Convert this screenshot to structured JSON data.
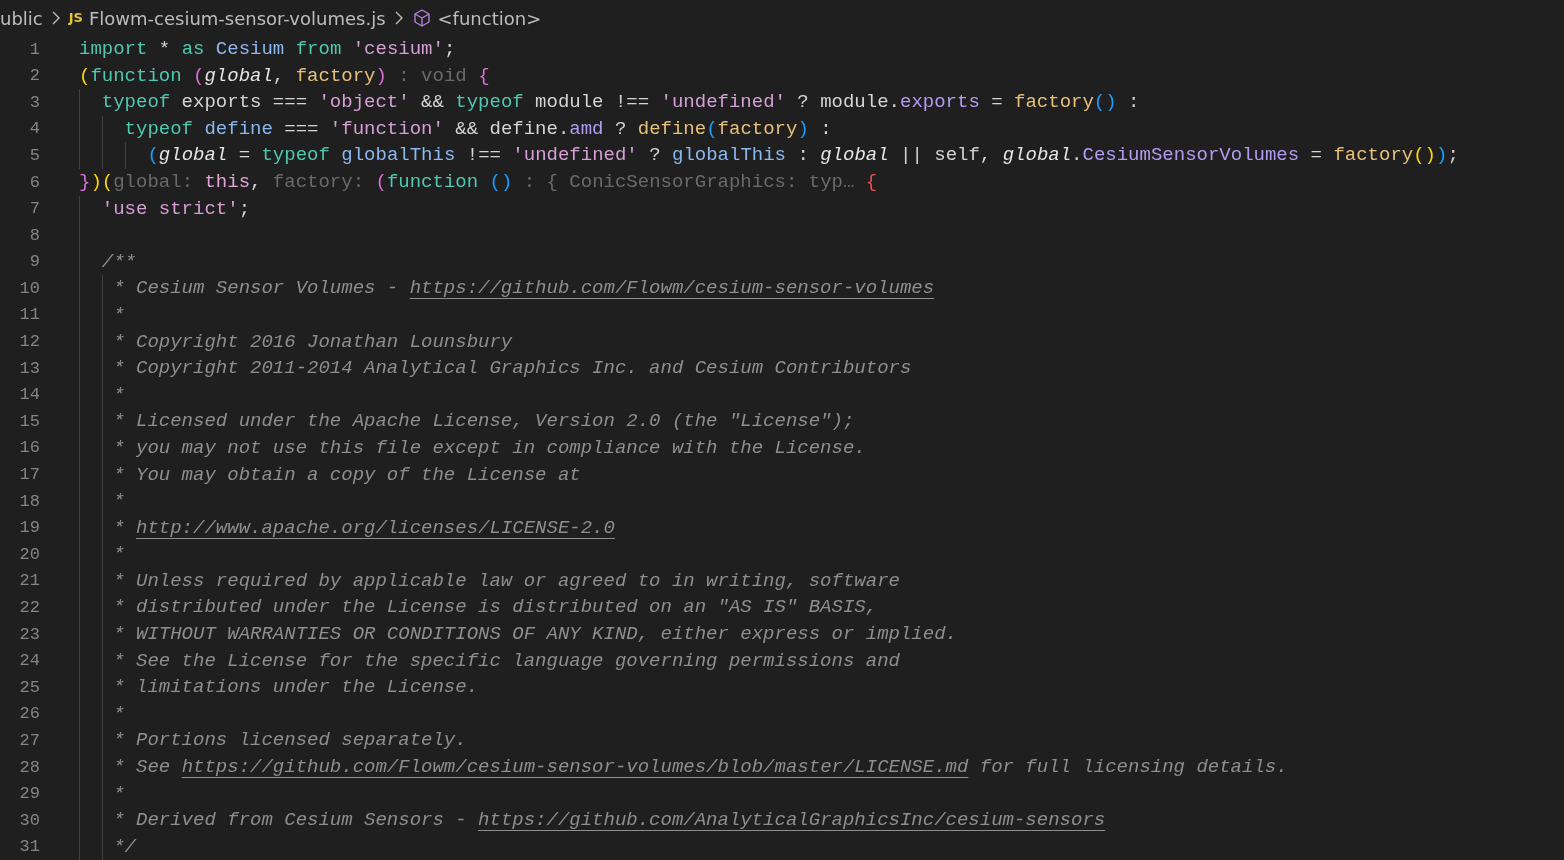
{
  "breadcrumb": [
    {
      "kind": "folder",
      "label": "ublic"
    },
    {
      "kind": "file",
      "badge": "JS",
      "label": "Flowm-cesium-sensor-volumes.js"
    },
    {
      "kind": "symbol",
      "label": "<function>"
    }
  ],
  "lines": [
    {
      "number": "1",
      "tokens": [
        {
          "kind": "kw",
          "text": "import"
        },
        {
          "kind": "plain",
          "text": " * "
        },
        {
          "kind": "kw",
          "text": "as "
        },
        {
          "kind": "var",
          "text": "Cesium "
        },
        {
          "kind": "kw",
          "text": "from "
        },
        {
          "kind": "str",
          "text": "'cesium'"
        },
        {
          "kind": "plain",
          "text": ";"
        }
      ]
    },
    {
      "number": "2",
      "tokens": [
        {
          "kind": "b1",
          "text": "("
        },
        {
          "kind": "kw",
          "text": "function "
        },
        {
          "kind": "b2",
          "text": "("
        },
        {
          "kind": "param",
          "text": "global"
        },
        {
          "kind": "plain",
          "text": ", "
        },
        {
          "kind": "fn",
          "text": "factory"
        },
        {
          "kind": "b2",
          "text": ")"
        },
        {
          "kind": "hint",
          "text": " : void "
        },
        {
          "kind": "b2",
          "text": "{"
        }
      ]
    },
    {
      "number": "3",
      "tokens": [
        {
          "kind": "kw",
          "text": "  typeof"
        },
        {
          "kind": "plain",
          "text": " exports === "
        },
        {
          "kind": "str",
          "text": "'object'"
        },
        {
          "kind": "plain",
          "text": " && "
        },
        {
          "kind": "kw",
          "text": "typeof"
        },
        {
          "kind": "plain",
          "text": " module !== "
        },
        {
          "kind": "str",
          "text": "'undefined'"
        },
        {
          "kind": "plain",
          "text": " ? module."
        },
        {
          "kind": "prop",
          "text": "exports"
        },
        {
          "kind": "plain",
          "text": " = "
        },
        {
          "kind": "fn",
          "text": "factory"
        },
        {
          "kind": "b3",
          "text": "()"
        },
        {
          "kind": "plain",
          "text": " :"
        }
      ]
    },
    {
      "number": "4",
      "tokens": [
        {
          "kind": "kw",
          "text": "    typeof "
        },
        {
          "kind": "var",
          "text": "define"
        },
        {
          "kind": "plain",
          "text": " === "
        },
        {
          "kind": "str",
          "text": "'function'"
        },
        {
          "kind": "plain",
          "text": " && define."
        },
        {
          "kind": "prop",
          "text": "amd"
        },
        {
          "kind": "plain",
          "text": " ? "
        },
        {
          "kind": "fn",
          "text": "define"
        },
        {
          "kind": "b3",
          "text": "("
        },
        {
          "kind": "fn",
          "text": "factory"
        },
        {
          "kind": "b3",
          "text": ")"
        },
        {
          "kind": "plain",
          "text": " :"
        }
      ]
    },
    {
      "number": "5",
      "tokens": [
        {
          "kind": "b3",
          "text": "      ("
        },
        {
          "kind": "param",
          "text": "global"
        },
        {
          "kind": "plain",
          "text": " = "
        },
        {
          "kind": "kw",
          "text": "typeof "
        },
        {
          "kind": "var",
          "text": "globalThis"
        },
        {
          "kind": "plain",
          "text": " !== "
        },
        {
          "kind": "str",
          "text": "'undefined'"
        },
        {
          "kind": "plain",
          "text": " ? "
        },
        {
          "kind": "var",
          "text": "globalThis"
        },
        {
          "kind": "plain",
          "text": " : "
        },
        {
          "kind": "param",
          "text": "global"
        },
        {
          "kind": "plain",
          "text": " || self, "
        },
        {
          "kind": "param",
          "text": "global"
        },
        {
          "kind": "plain",
          "text": "."
        },
        {
          "kind": "prop",
          "text": "CesiumSensorVolumes"
        },
        {
          "kind": "plain",
          "text": " = "
        },
        {
          "kind": "fn",
          "text": "factory"
        },
        {
          "kind": "b1",
          "text": "()"
        },
        {
          "kind": "b3",
          "text": ")"
        },
        {
          "kind": "plain",
          "text": ";"
        }
      ]
    },
    {
      "number": "6",
      "tokens": [
        {
          "kind": "b2",
          "text": "}"
        },
        {
          "kind": "b1",
          "text": ")("
        },
        {
          "kind": "hint",
          "text": "global: "
        },
        {
          "kind": "this",
          "text": "this"
        },
        {
          "kind": "plain",
          "text": ", "
        },
        {
          "kind": "hint",
          "text": "factory: "
        },
        {
          "kind": "b2",
          "text": "("
        },
        {
          "kind": "kw",
          "text": "function "
        },
        {
          "kind": "b3",
          "text": "()"
        },
        {
          "kind": "hint",
          "text": " : { ConicSensorGraphics: typ… "
        },
        {
          "kind": "berr",
          "text": "{"
        }
      ]
    },
    {
      "number": "7",
      "tokens": [
        {
          "kind": "str",
          "text": "  'use strict'"
        },
        {
          "kind": "plain",
          "text": ";"
        }
      ]
    },
    {
      "number": "8"
    },
    {
      "number": "9",
      "tokens": [
        {
          "kind": "cmt",
          "text": "  /**"
        }
      ]
    },
    {
      "number": "10",
      "tokens": [
        {
          "kind": "cmt",
          "text": "   * Cesium Sensor Volumes - "
        },
        {
          "kind": "link",
          "text": "https://github.com/Flowm/cesium-sensor-volumes"
        }
      ]
    },
    {
      "number": "11",
      "tokens": [
        {
          "kind": "cmt",
          "text": "   *"
        }
      ]
    },
    {
      "number": "12",
      "tokens": [
        {
          "kind": "cmt",
          "text": "   * Copyright 2016 Jonathan Lounsbury"
        }
      ]
    },
    {
      "number": "13",
      "tokens": [
        {
          "kind": "cmt",
          "text": "   * Copyright 2011-2014 Analytical Graphics Inc. and Cesium Contributors"
        }
      ]
    },
    {
      "number": "14",
      "tokens": [
        {
          "kind": "cmt",
          "text": "   *"
        }
      ]
    },
    {
      "number": "15",
      "tokens": [
        {
          "kind": "cmt",
          "text": "   * Licensed under the Apache License, Version 2.0 (the \"License\");"
        }
      ]
    },
    {
      "number": "16",
      "tokens": [
        {
          "kind": "cmt",
          "text": "   * you may not use this file except in compliance with the License."
        }
      ]
    },
    {
      "number": "17",
      "tokens": [
        {
          "kind": "cmt",
          "text": "   * You may obtain a copy of the License at"
        }
      ]
    },
    {
      "number": "18",
      "tokens": [
        {
          "kind": "cmt",
          "text": "   *"
        }
      ]
    },
    {
      "number": "19",
      "tokens": [
        {
          "kind": "cmt",
          "text": "   * "
        },
        {
          "kind": "link",
          "text": "http://www.apache.org/licenses/LICENSE-2.0"
        }
      ]
    },
    {
      "number": "20",
      "tokens": [
        {
          "kind": "cmt",
          "text": "   *"
        }
      ]
    },
    {
      "number": "21",
      "tokens": [
        {
          "kind": "cmt",
          "text": "   * Unless required by applicable law or agreed to in writing, software"
        }
      ]
    },
    {
      "number": "22",
      "tokens": [
        {
          "kind": "cmt",
          "text": "   * distributed under the License is distributed on an \"AS IS\" BASIS,"
        }
      ]
    },
    {
      "number": "23",
      "tokens": [
        {
          "kind": "cmt",
          "text": "   * WITHOUT WARRANTIES OR CONDITIONS OF ANY KIND, either express or implied."
        }
      ]
    },
    {
      "number": "24",
      "tokens": [
        {
          "kind": "cmt",
          "text": "   * See the License for the specific language governing permissions and"
        }
      ]
    },
    {
      "number": "25",
      "tokens": [
        {
          "kind": "cmt",
          "text": "   * limitations under the License."
        }
      ]
    },
    {
      "number": "26",
      "tokens": [
        {
          "kind": "cmt",
          "text": "   *"
        }
      ]
    },
    {
      "number": "27",
      "tokens": [
        {
          "kind": "cmt",
          "text": "   * Portions licensed separately."
        }
      ]
    },
    {
      "number": "28",
      "tokens": [
        {
          "kind": "cmt",
          "text": "   * See "
        },
        {
          "kind": "link",
          "text": "https://github.com/Flowm/cesium-sensor-volumes/blob/master/LICENSE.md"
        },
        {
          "kind": "cmt",
          "text": " for full licensing details."
        }
      ]
    },
    {
      "number": "29",
      "tokens": [
        {
          "kind": "cmt",
          "text": "   *"
        }
      ]
    },
    {
      "number": "30",
      "tokens": [
        {
          "kind": "cmt",
          "text": "   * Derived from Cesium Sensors - "
        },
        {
          "kind": "link",
          "text": "https://github.com/AnalyticalGraphicsInc/cesium-sensors"
        }
      ]
    },
    {
      "number": "31",
      "tokens": [
        {
          "kind": "cmt",
          "text": "   */"
        }
      ]
    }
  ]
}
